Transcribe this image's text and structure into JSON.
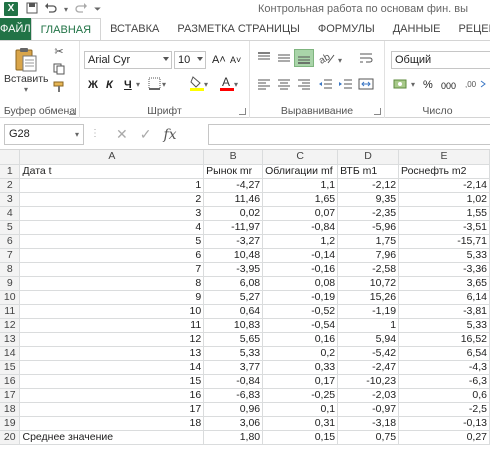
{
  "app": {
    "logo_letter": "X",
    "window_title": "Контрольная работа по основам фин. вы"
  },
  "ribbon": {
    "tabs": [
      "ФАЙЛ",
      "ГЛАВНАЯ",
      "ВСТАВКА",
      "РАЗМЕТКА СТРАНИЦЫ",
      "ФОРМУЛЫ",
      "ДАННЫЕ",
      "РЕЦЕН"
    ],
    "clipboard": {
      "paste_label": "Вставить",
      "group_label": "Буфер обмена"
    },
    "font": {
      "font_name": "Arial Cyr",
      "font_size": "10",
      "grow": "A˄",
      "shrink": "A˅",
      "bold": "Ж",
      "italic": "К",
      "underline": "Ч",
      "group_label": "Шрифт"
    },
    "alignment": {
      "group_label": "Выравнивание"
    },
    "number": {
      "format": "Общий",
      "group_label": "Число",
      "percent": "%",
      "thousands": "000"
    },
    "colors": {
      "accent": "#217346",
      "fill_highlight": "#ffff00",
      "font_color": "#ff0000"
    }
  },
  "formula_bar": {
    "name_box": "G28",
    "fx_label": "fx",
    "formula": ""
  },
  "sheet": {
    "columns": [
      "A",
      "B",
      "C",
      "D",
      "E"
    ],
    "rows": [
      {
        "n": "1",
        "a": "Дата t",
        "b": "Рынок mr",
        "c": "Облигации mf",
        "d": "ВТБ m1",
        "e": "Роснефть m2"
      },
      {
        "n": "2",
        "a": "1",
        "b": "-4,27",
        "c": "1,1",
        "d": "-2,12",
        "e": "-2,14"
      },
      {
        "n": "3",
        "a": "2",
        "b": "11,46",
        "c": "1,65",
        "d": "9,35",
        "e": "1,02"
      },
      {
        "n": "4",
        "a": "3",
        "b": "0,02",
        "c": "0,07",
        "d": "-2,35",
        "e": "1,55"
      },
      {
        "n": "5",
        "a": "4",
        "b": "-11,97",
        "c": "-0,84",
        "d": "-5,96",
        "e": "-3,51"
      },
      {
        "n": "6",
        "a": "5",
        "b": "-3,27",
        "c": "1,2",
        "d": "1,75",
        "e": "-15,71"
      },
      {
        "n": "7",
        "a": "6",
        "b": "10,48",
        "c": "-0,14",
        "d": "7,96",
        "e": "5,33"
      },
      {
        "n": "8",
        "a": "7",
        "b": "-3,95",
        "c": "-0,16",
        "d": "-2,58",
        "e": "-3,36"
      },
      {
        "n": "9",
        "a": "8",
        "b": "6,08",
        "c": "0,08",
        "d": "10,72",
        "e": "3,65"
      },
      {
        "n": "10",
        "a": "9",
        "b": "5,27",
        "c": "-0,19",
        "d": "15,26",
        "e": "6,14"
      },
      {
        "n": "11",
        "a": "10",
        "b": "0,64",
        "c": "-0,52",
        "d": "-1,19",
        "e": "-3,81"
      },
      {
        "n": "12",
        "a": "11",
        "b": "10,83",
        "c": "-0,54",
        "d": "1",
        "e": "5,33"
      },
      {
        "n": "13",
        "a": "12",
        "b": "5,65",
        "c": "0,16",
        "d": "5,94",
        "e": "16,52"
      },
      {
        "n": "14",
        "a": "13",
        "b": "5,33",
        "c": "0,2",
        "d": "-5,42",
        "e": "6,54"
      },
      {
        "n": "15",
        "a": "14",
        "b": "3,77",
        "c": "0,33",
        "d": "-2,47",
        "e": "-4,3"
      },
      {
        "n": "16",
        "a": "15",
        "b": "-0,84",
        "c": "0,17",
        "d": "-10,23",
        "e": "-6,3"
      },
      {
        "n": "17",
        "a": "16",
        "b": "-6,83",
        "c": "-0,25",
        "d": "-2,03",
        "e": "0,6"
      },
      {
        "n": "18",
        "a": "17",
        "b": "0,96",
        "c": "0,1",
        "d": "-0,97",
        "e": "-2,5"
      },
      {
        "n": "19",
        "a": "18",
        "b": "3,06",
        "c": "0,31",
        "d": "-3,18",
        "e": "-0,13"
      },
      {
        "n": "20",
        "a": "Среднее значение",
        "b": "1,80",
        "c": "0,15",
        "d": "0,75",
        "e": "0,27"
      }
    ]
  }
}
